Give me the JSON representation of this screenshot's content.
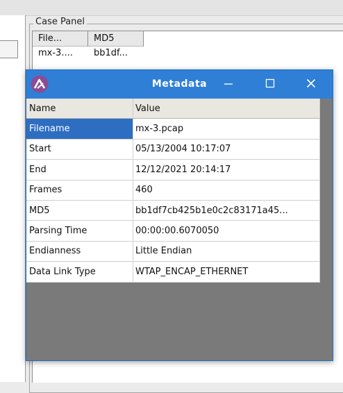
{
  "case_panel": {
    "title": "Case Panel",
    "columns": [
      "File...",
      "MD5"
    ],
    "rows": [
      [
        "mx-3....",
        "bb1df..."
      ]
    ]
  },
  "dialog": {
    "title": "Metadata",
    "icon": "app-logo-icon",
    "controls": {
      "minimize": "minimize-icon",
      "maximize": "maximize-icon",
      "close": "close-icon"
    },
    "columns": {
      "name": "Name",
      "value": "Value"
    },
    "rows": [
      {
        "name": "Filename",
        "value": "mx-3.pcap",
        "selected": true
      },
      {
        "name": "Start",
        "value": "05/13/2004 10:17:07"
      },
      {
        "name": "End",
        "value": "12/12/2021 20:14:17"
      },
      {
        "name": "Frames",
        "value": "460"
      },
      {
        "name": "MD5",
        "value": "bb1df7cb425b1e0c2c83171a45..."
      },
      {
        "name": "Parsing Time",
        "value": "00:00:00.6070050"
      },
      {
        "name": "Endianness",
        "value": "Little Endian"
      },
      {
        "name": "Data Link Type",
        "value": "WTAP_ENCAP_ETHERNET"
      }
    ]
  },
  "colors": {
    "titlebar": "#2f7fd6",
    "selection": "#2e6ec2",
    "dialog_background": "#7a7a7a"
  }
}
